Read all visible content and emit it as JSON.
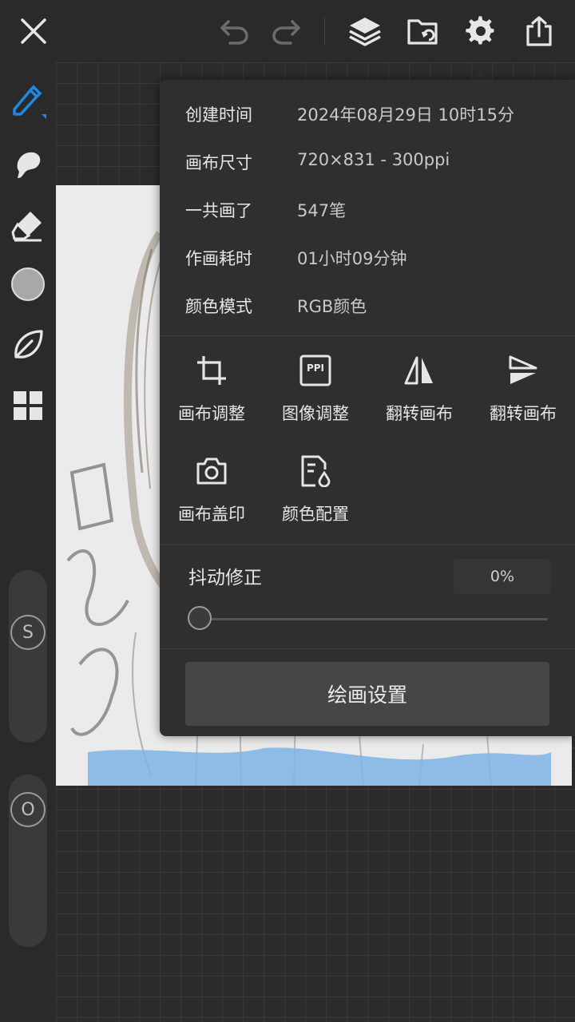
{
  "info": {
    "created_label": "创建时间",
    "created_value": "2024年08月29日 10时15分",
    "canvas_size_label": "画布尺寸",
    "canvas_size_value": "720×831 - 300ppi",
    "strokes_label": "一共画了",
    "strokes_value": "547笔",
    "time_label": "作画耗时",
    "time_value": "01小时09分钟",
    "color_mode_label": "颜色模式",
    "color_mode_value": "RGB颜色"
  },
  "tools": [
    {
      "label": "画布调整",
      "icon": "crop-icon"
    },
    {
      "label": "图像调整",
      "icon": "ppi-icon"
    },
    {
      "label": "翻转画布",
      "icon": "flip-horizontal-icon"
    },
    {
      "label": "翻转画布",
      "icon": "flip-vertical-icon"
    },
    {
      "label": "画布盖印",
      "icon": "camera-icon"
    },
    {
      "label": "颜色配置",
      "icon": "color-profile-icon"
    }
  ],
  "ppi_badge": "PPI",
  "jitter": {
    "label": "抖动修正",
    "value": "0%",
    "level": 0
  },
  "paint_settings_label": "绘画设置",
  "left_toolbar": {
    "size_label": "S",
    "opacity_label": "O"
  },
  "colors": {
    "accent": "#1e88e5",
    "panel": "#2f2f2f",
    "background": "#2a2a2a"
  }
}
